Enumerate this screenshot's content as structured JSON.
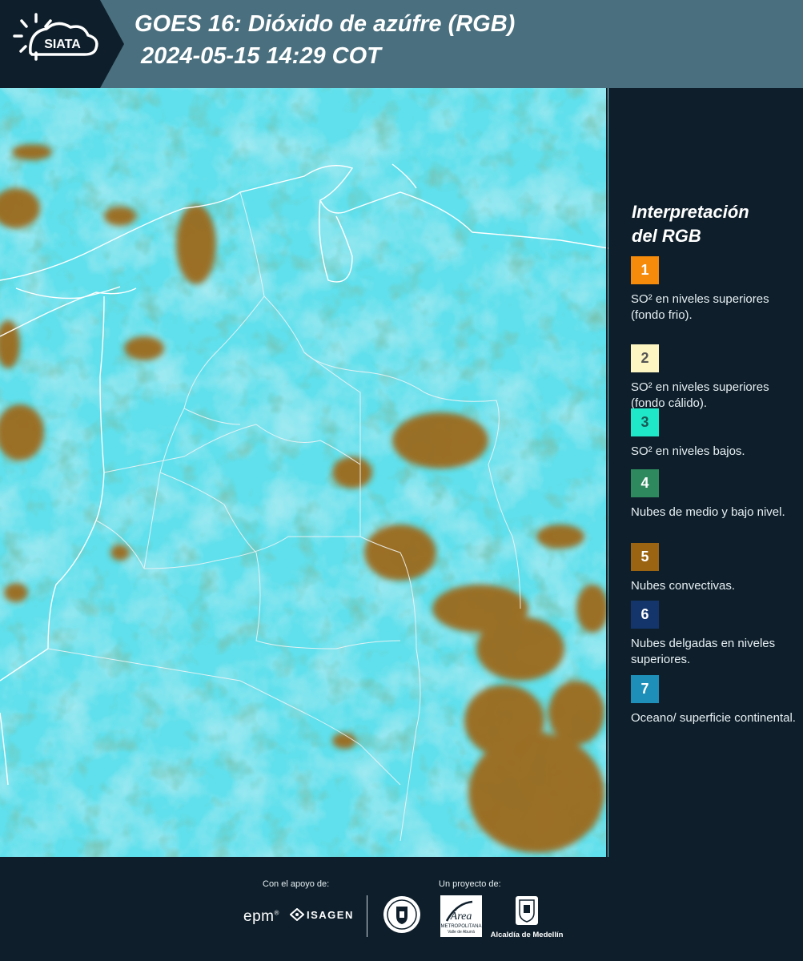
{
  "header": {
    "logo_text": "SIATA",
    "title_line1": "GOES 16: Dióxido de azúfre (RGB)",
    "title_line2": "2024-05-15 14:29 COT"
  },
  "legend": {
    "title_line1": "Interpretación",
    "title_line2": "del RGB",
    "items": [
      {
        "number": "1",
        "color": "#f58a0b",
        "text_color": "#ffffff",
        "label": "SO² en niveles superiores (fondo frio)."
      },
      {
        "number": "2",
        "color": "#fdf6c2",
        "text_color": "#555555",
        "label": "SO² en niveles superiores (fondo cálido)."
      },
      {
        "number": "3",
        "color": "#1fe8c9",
        "text_color": "#1a5a55",
        "label": "SO² en niveles bajos."
      },
      {
        "number": "4",
        "color": "#2e8a5e",
        "text_color": "#ffffff",
        "label": "Nubes de medio y bajo nivel."
      },
      {
        "number": "5",
        "color": "#9a6412",
        "text_color": "#ffffff",
        "label": "Nubes convectivas."
      },
      {
        "number": "6",
        "color": "#13356b",
        "text_color": "#ffffff",
        "label": "Nubes delgadas en niveles superiores."
      },
      {
        "number": "7",
        "color": "#1d8fb8",
        "text_color": "#ffffff",
        "label": "Oceano/ superficie continental."
      }
    ]
  },
  "footer": {
    "support_label": "Con el apoyo de:",
    "project_label": "Un proyecto de:",
    "epm": "epm",
    "isagen": "ISAGEN",
    "area_metro": "Área",
    "area_metro_sub": "METROPOLITANA",
    "area_metro_sub2": "Valle de Aburrá",
    "alcaldia": "Alcaldía de Medellín"
  }
}
